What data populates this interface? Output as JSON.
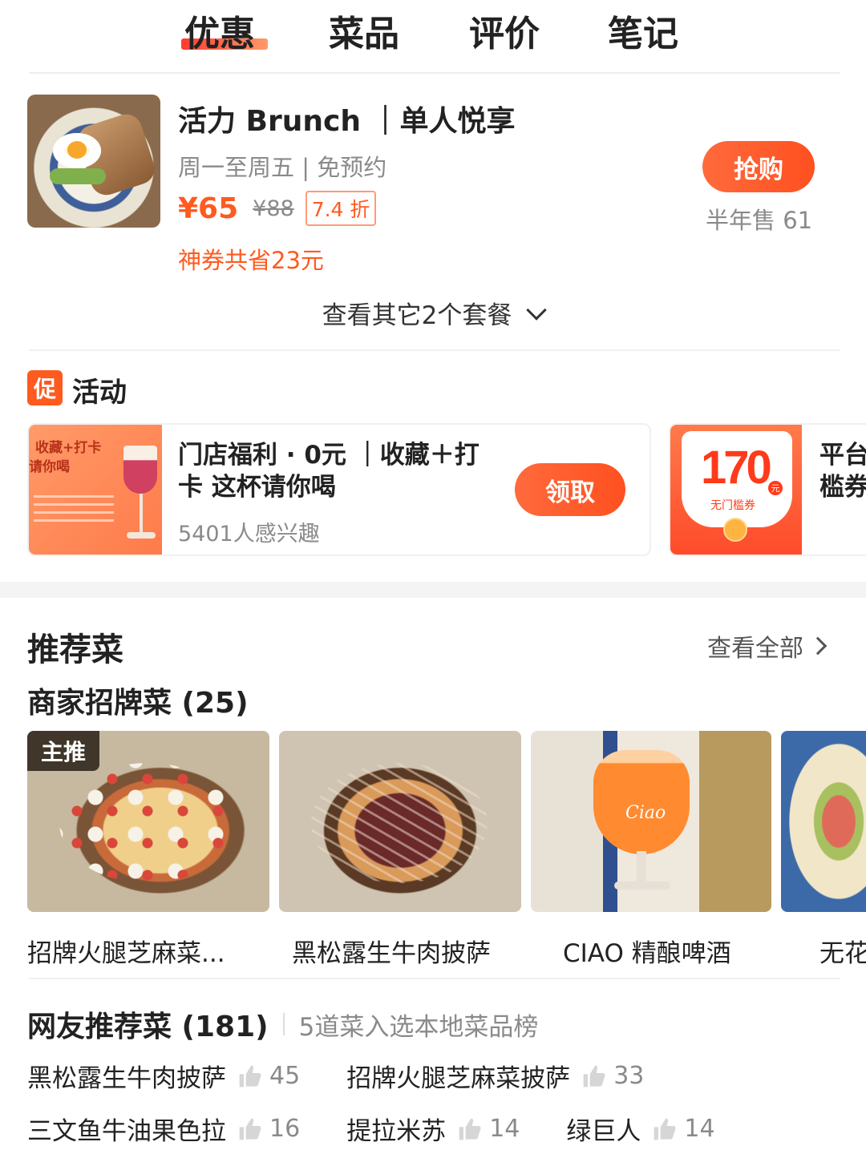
{
  "tabs": [
    {
      "label": "优惠",
      "active": true
    },
    {
      "label": "菜品",
      "active": false
    },
    {
      "label": "评价",
      "active": false
    },
    {
      "label": "笔记",
      "active": false
    }
  ],
  "deal": {
    "title": "活力 Brunch ｜单人悦享",
    "subtitle": "周一至周五 | 免预约",
    "price_now": "¥65",
    "price_old": "¥88",
    "discount": "7.4 折",
    "savings": "神券共省23元",
    "buy_label": "抢购",
    "sold": "半年售 61",
    "more_packages": "查看其它2个套餐"
  },
  "activity": {
    "badge": "促",
    "title": "活动",
    "card1": {
      "thumb_line1": "收藏+打卡",
      "thumb_line2": "请你喝",
      "title": "门店福利 · 0元 ｜收藏＋打卡 这杯请你喝",
      "interest": "5401人感兴趣",
      "claim_label": "领取"
    },
    "card2": {
      "coupon_amount": "170",
      "coupon_unit": "元",
      "coupon_label": "无门槛券",
      "title_line1": "平台",
      "title_line2": "槛券"
    }
  },
  "recommended": {
    "title": "推荐菜",
    "view_all": "查看全部",
    "signature_title": "商家招牌菜 (25)",
    "main_tag": "主推",
    "dishes": [
      {
        "name": "招牌火腿芝麻菜..."
      },
      {
        "name": "黑松露生牛肉披萨"
      },
      {
        "name": "CIAO 精酿啤酒",
        "image_text": "Ciao"
      },
      {
        "name": "无花"
      }
    ],
    "netizen_title": "网友推荐菜 (181)",
    "netizen_sub": "5道菜入选本地菜品榜",
    "likes": [
      {
        "name": "黑松露生牛肉披萨",
        "count": "45"
      },
      {
        "name": "招牌火腿芝麻菜披萨",
        "count": "33"
      },
      {
        "name": "三文鱼牛油果色拉",
        "count": "16"
      },
      {
        "name": "提拉米苏",
        "count": "14"
      },
      {
        "name": "绿巨人",
        "count": "14"
      }
    ]
  },
  "colors": {
    "accent": "#ff5a1f",
    "tab_underline": "#ff3b30",
    "muted": "#8a8a8a"
  }
}
